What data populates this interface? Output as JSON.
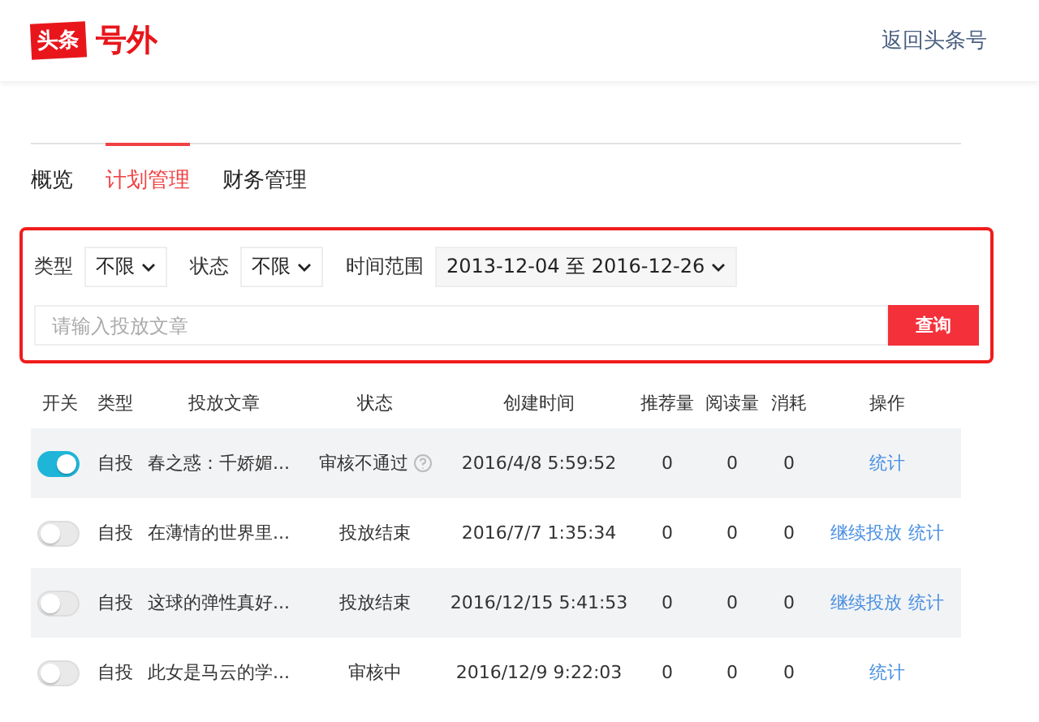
{
  "header": {
    "logo_badge": "头条",
    "logo_text": "号外",
    "back_link": "返回头条号"
  },
  "tabs": [
    {
      "label": "概览",
      "selected": false
    },
    {
      "label": "计划管理",
      "selected": true
    },
    {
      "label": "财务管理",
      "selected": false
    }
  ],
  "filters": [
    {
      "label": "类型",
      "value": "不限"
    },
    {
      "label": "状态",
      "value": "不限"
    },
    {
      "label": "时间范围",
      "value": "2013-12-04 至 2016-12-26"
    }
  ],
  "search": {
    "placeholder": "请输入投放文章",
    "button": "查询"
  },
  "table": {
    "columns": [
      "开关",
      "类型",
      "投放文章",
      "状态",
      "创建时间",
      "推荐量",
      "阅读量",
      "消耗",
      "操作"
    ],
    "rows": [
      {
        "on": true,
        "type": "自投",
        "article": "春之惑：千娇媚...",
        "status": "审核不通过",
        "status_help": true,
        "created": "2016/4/8 5:59:52",
        "recommend": "0",
        "reads": "0",
        "cost": "0",
        "actions": [
          "统计"
        ]
      },
      {
        "on": false,
        "type": "自投",
        "article": "在薄情的世界里...",
        "status": "投放结束",
        "status_help": false,
        "created": "2016/7/7 1:35:34",
        "recommend": "0",
        "reads": "0",
        "cost": "0",
        "actions": [
          "继续投放",
          "统计"
        ]
      },
      {
        "on": false,
        "type": "自投",
        "article": "这球的弹性真好...",
        "status": "投放结束",
        "status_help": false,
        "created": "2016/12/15 5:41:53",
        "recommend": "0",
        "reads": "0",
        "cost": "0",
        "actions": [
          "继续投放",
          "统计"
        ]
      },
      {
        "on": false,
        "type": "自投",
        "article": "此女是马云的学...",
        "status": "审核中",
        "status_help": false,
        "created": "2016/12/9 9:22:03",
        "recommend": "0",
        "reads": "0",
        "cost": "0",
        "actions": [
          "统计"
        ]
      }
    ]
  }
}
